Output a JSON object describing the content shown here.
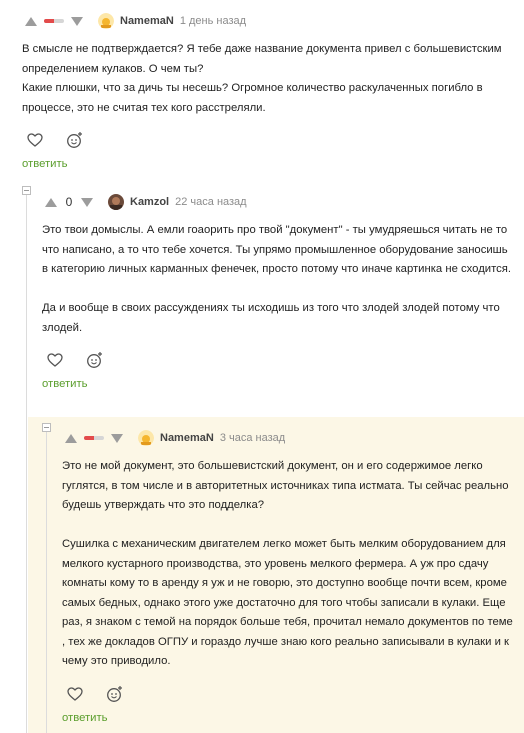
{
  "comments": [
    {
      "author": "NamemaN",
      "time": "1 день назад",
      "rating_shown": "",
      "paragraphs": [
        "В смысле не подтверждается? Я тебе даже название документа привел с большевистским определением кулаков. О чем ты?",
        "Какие плюшки, что за дичь ты несешь? Огромное количество раскулаченных погибло в процессе, это не считая тех кого расстреляли."
      ],
      "reply_label": "ответить",
      "avatar_icon": "sun-avatar-icon"
    },
    {
      "author": "Kamzol",
      "time": "22 часа назад",
      "rating": "0",
      "paragraphs": [
        "Это твои домыслы. А емли гоаорить про твой \"документ\" - ты умудряешься читать не то что написано, а то что тебе хочется. Ты упрямо промышленное оборудование заносишь в категорию личных карманных фенечек, просто потому что иначе картинка не сходится.",
        "Да и вообще в своих рассуждениях ты исходишь из того что злодей злодей потому что злодей."
      ],
      "reply_label": "ответить",
      "avatar_icon": "photo-avatar-icon"
    },
    {
      "author": "NamemaN",
      "time": "3 часа назад",
      "rating_shown": "",
      "paragraphs": [
        "Это не мой документ, это большевистский документ, он и его содержимое легко гуглятся, в том числе и в авторитетных источниках типа истмата. Ты сейчас реально будешь утверждать что это подделка?",
        "Сушилка с механическим двигателем легко может быть мелким оборудованием для мелкого кустарного производства, это уровень мелкого фермера. А уж про сдачу комнаты кому то в аренду я уж и не говорю, это доступно вообще почти всем, кроме самых бедных, однако этого уже достаточно для того чтобы записали в кулаки. Еще раз, я знаком с темой на порядок больше тебя, прочитал немало документов по теме , тех же докладов ОГПУ и гораздо лучше знаю кого реально записывали в кулаки и к чему это приводило."
      ],
      "reply_label": "ответить",
      "avatar_icon": "sun-avatar-icon"
    }
  ],
  "colors": {
    "accent_green": "#5a9e2c",
    "highlight_bg": "#fcf7e6",
    "negative_red": "#e34b4b"
  }
}
